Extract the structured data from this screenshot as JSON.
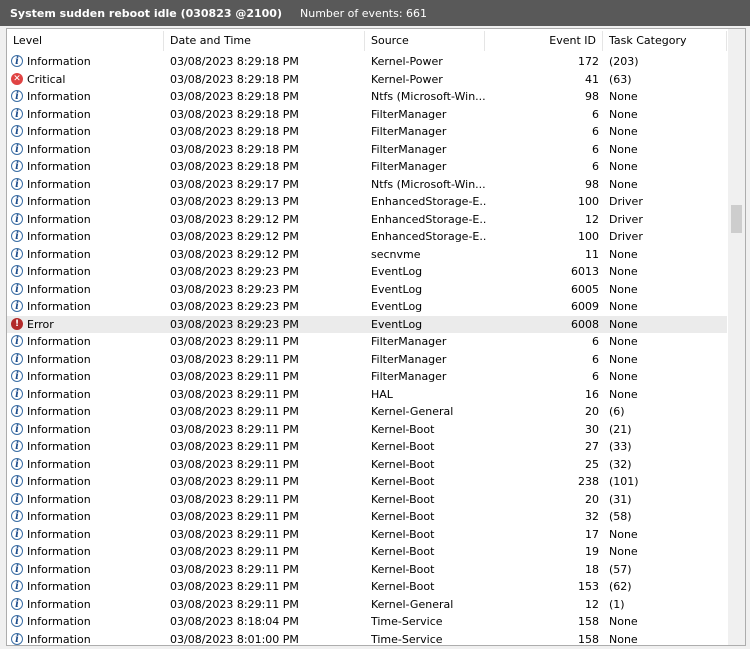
{
  "window": {
    "log_name": "System sudden reboot idle (030823 @2100)",
    "event_count": "Number of events: 661"
  },
  "columns": {
    "level": "Level",
    "date": "Date and Time",
    "source": "Source",
    "event_id": "Event ID",
    "task": "Task Category"
  },
  "colors": {
    "titlebar": "#595959",
    "selected_row": "#ebebeb",
    "critical": "#e04343",
    "error": "#b22a2a",
    "info": "#3a6ea5"
  },
  "rows": [
    {
      "level": "Information",
      "icon": "info",
      "date": "03/08/2023 8:29:18 PM",
      "source": "Kernel-Power",
      "id": "172",
      "task": "(203)"
    },
    {
      "level": "Critical",
      "icon": "critical",
      "date": "03/08/2023 8:29:18 PM",
      "source": "Kernel-Power",
      "id": "41",
      "task": "(63)"
    },
    {
      "level": "Information",
      "icon": "info",
      "date": "03/08/2023 8:29:18 PM",
      "source": "Ntfs (Microsoft-Win...",
      "id": "98",
      "task": "None"
    },
    {
      "level": "Information",
      "icon": "info",
      "date": "03/08/2023 8:29:18 PM",
      "source": "FilterManager",
      "id": "6",
      "task": "None"
    },
    {
      "level": "Information",
      "icon": "info",
      "date": "03/08/2023 8:29:18 PM",
      "source": "FilterManager",
      "id": "6",
      "task": "None"
    },
    {
      "level": "Information",
      "icon": "info",
      "date": "03/08/2023 8:29:18 PM",
      "source": "FilterManager",
      "id": "6",
      "task": "None"
    },
    {
      "level": "Information",
      "icon": "info",
      "date": "03/08/2023 8:29:18 PM",
      "source": "FilterManager",
      "id": "6",
      "task": "None"
    },
    {
      "level": "Information",
      "icon": "info",
      "date": "03/08/2023 8:29:17 PM",
      "source": "Ntfs (Microsoft-Win...",
      "id": "98",
      "task": "None"
    },
    {
      "level": "Information",
      "icon": "info",
      "date": "03/08/2023 8:29:13 PM",
      "source": "EnhancedStorage-E...",
      "id": "100",
      "task": "Driver"
    },
    {
      "level": "Information",
      "icon": "info",
      "date": "03/08/2023 8:29:12 PM",
      "source": "EnhancedStorage-E...",
      "id": "12",
      "task": "Driver"
    },
    {
      "level": "Information",
      "icon": "info",
      "date": "03/08/2023 8:29:12 PM",
      "source": "EnhancedStorage-E...",
      "id": "100",
      "task": "Driver"
    },
    {
      "level": "Information",
      "icon": "info",
      "date": "03/08/2023 8:29:12 PM",
      "source": "secnvme",
      "id": "11",
      "task": "None"
    },
    {
      "level": "Information",
      "icon": "info",
      "date": "03/08/2023 8:29:23 PM",
      "source": "EventLog",
      "id": "6013",
      "task": "None"
    },
    {
      "level": "Information",
      "icon": "info",
      "date": "03/08/2023 8:29:23 PM",
      "source": "EventLog",
      "id": "6005",
      "task": "None"
    },
    {
      "level": "Information",
      "icon": "info",
      "date": "03/08/2023 8:29:23 PM",
      "source": "EventLog",
      "id": "6009",
      "task": "None"
    },
    {
      "level": "Error",
      "icon": "error",
      "date": "03/08/2023 8:29:23 PM",
      "source": "EventLog",
      "id": "6008",
      "task": "None",
      "selected": true
    },
    {
      "level": "Information",
      "icon": "info",
      "date": "03/08/2023 8:29:11 PM",
      "source": "FilterManager",
      "id": "6",
      "task": "None"
    },
    {
      "level": "Information",
      "icon": "info",
      "date": "03/08/2023 8:29:11 PM",
      "source": "FilterManager",
      "id": "6",
      "task": "None"
    },
    {
      "level": "Information",
      "icon": "info",
      "date": "03/08/2023 8:29:11 PM",
      "source": "FilterManager",
      "id": "6",
      "task": "None"
    },
    {
      "level": "Information",
      "icon": "info",
      "date": "03/08/2023 8:29:11 PM",
      "source": "HAL",
      "id": "16",
      "task": "None"
    },
    {
      "level": "Information",
      "icon": "info",
      "date": "03/08/2023 8:29:11 PM",
      "source": "Kernel-General",
      "id": "20",
      "task": "(6)"
    },
    {
      "level": "Information",
      "icon": "info",
      "date": "03/08/2023 8:29:11 PM",
      "source": "Kernel-Boot",
      "id": "30",
      "task": "(21)"
    },
    {
      "level": "Information",
      "icon": "info",
      "date": "03/08/2023 8:29:11 PM",
      "source": "Kernel-Boot",
      "id": "27",
      "task": "(33)"
    },
    {
      "level": "Information",
      "icon": "info",
      "date": "03/08/2023 8:29:11 PM",
      "source": "Kernel-Boot",
      "id": "25",
      "task": "(32)"
    },
    {
      "level": "Information",
      "icon": "info",
      "date": "03/08/2023 8:29:11 PM",
      "source": "Kernel-Boot",
      "id": "238",
      "task": "(101)"
    },
    {
      "level": "Information",
      "icon": "info",
      "date": "03/08/2023 8:29:11 PM",
      "source": "Kernel-Boot",
      "id": "20",
      "task": "(31)"
    },
    {
      "level": "Information",
      "icon": "info",
      "date": "03/08/2023 8:29:11 PM",
      "source": "Kernel-Boot",
      "id": "32",
      "task": "(58)"
    },
    {
      "level": "Information",
      "icon": "info",
      "date": "03/08/2023 8:29:11 PM",
      "source": "Kernel-Boot",
      "id": "17",
      "task": "None"
    },
    {
      "level": "Information",
      "icon": "info",
      "date": "03/08/2023 8:29:11 PM",
      "source": "Kernel-Boot",
      "id": "19",
      "task": "None"
    },
    {
      "level": "Information",
      "icon": "info",
      "date": "03/08/2023 8:29:11 PM",
      "source": "Kernel-Boot",
      "id": "18",
      "task": "(57)"
    },
    {
      "level": "Information",
      "icon": "info",
      "date": "03/08/2023 8:29:11 PM",
      "source": "Kernel-Boot",
      "id": "153",
      "task": "(62)"
    },
    {
      "level": "Information",
      "icon": "info",
      "date": "03/08/2023 8:29:11 PM",
      "source": "Kernel-General",
      "id": "12",
      "task": "(1)"
    },
    {
      "level": "Information",
      "icon": "info",
      "date": "03/08/2023 8:18:04 PM",
      "source": "Time-Service",
      "id": "158",
      "task": "None"
    },
    {
      "level": "Information",
      "icon": "info",
      "date": "03/08/2023 8:01:00 PM",
      "source": "Time-Service",
      "id": "158",
      "task": "None"
    }
  ]
}
